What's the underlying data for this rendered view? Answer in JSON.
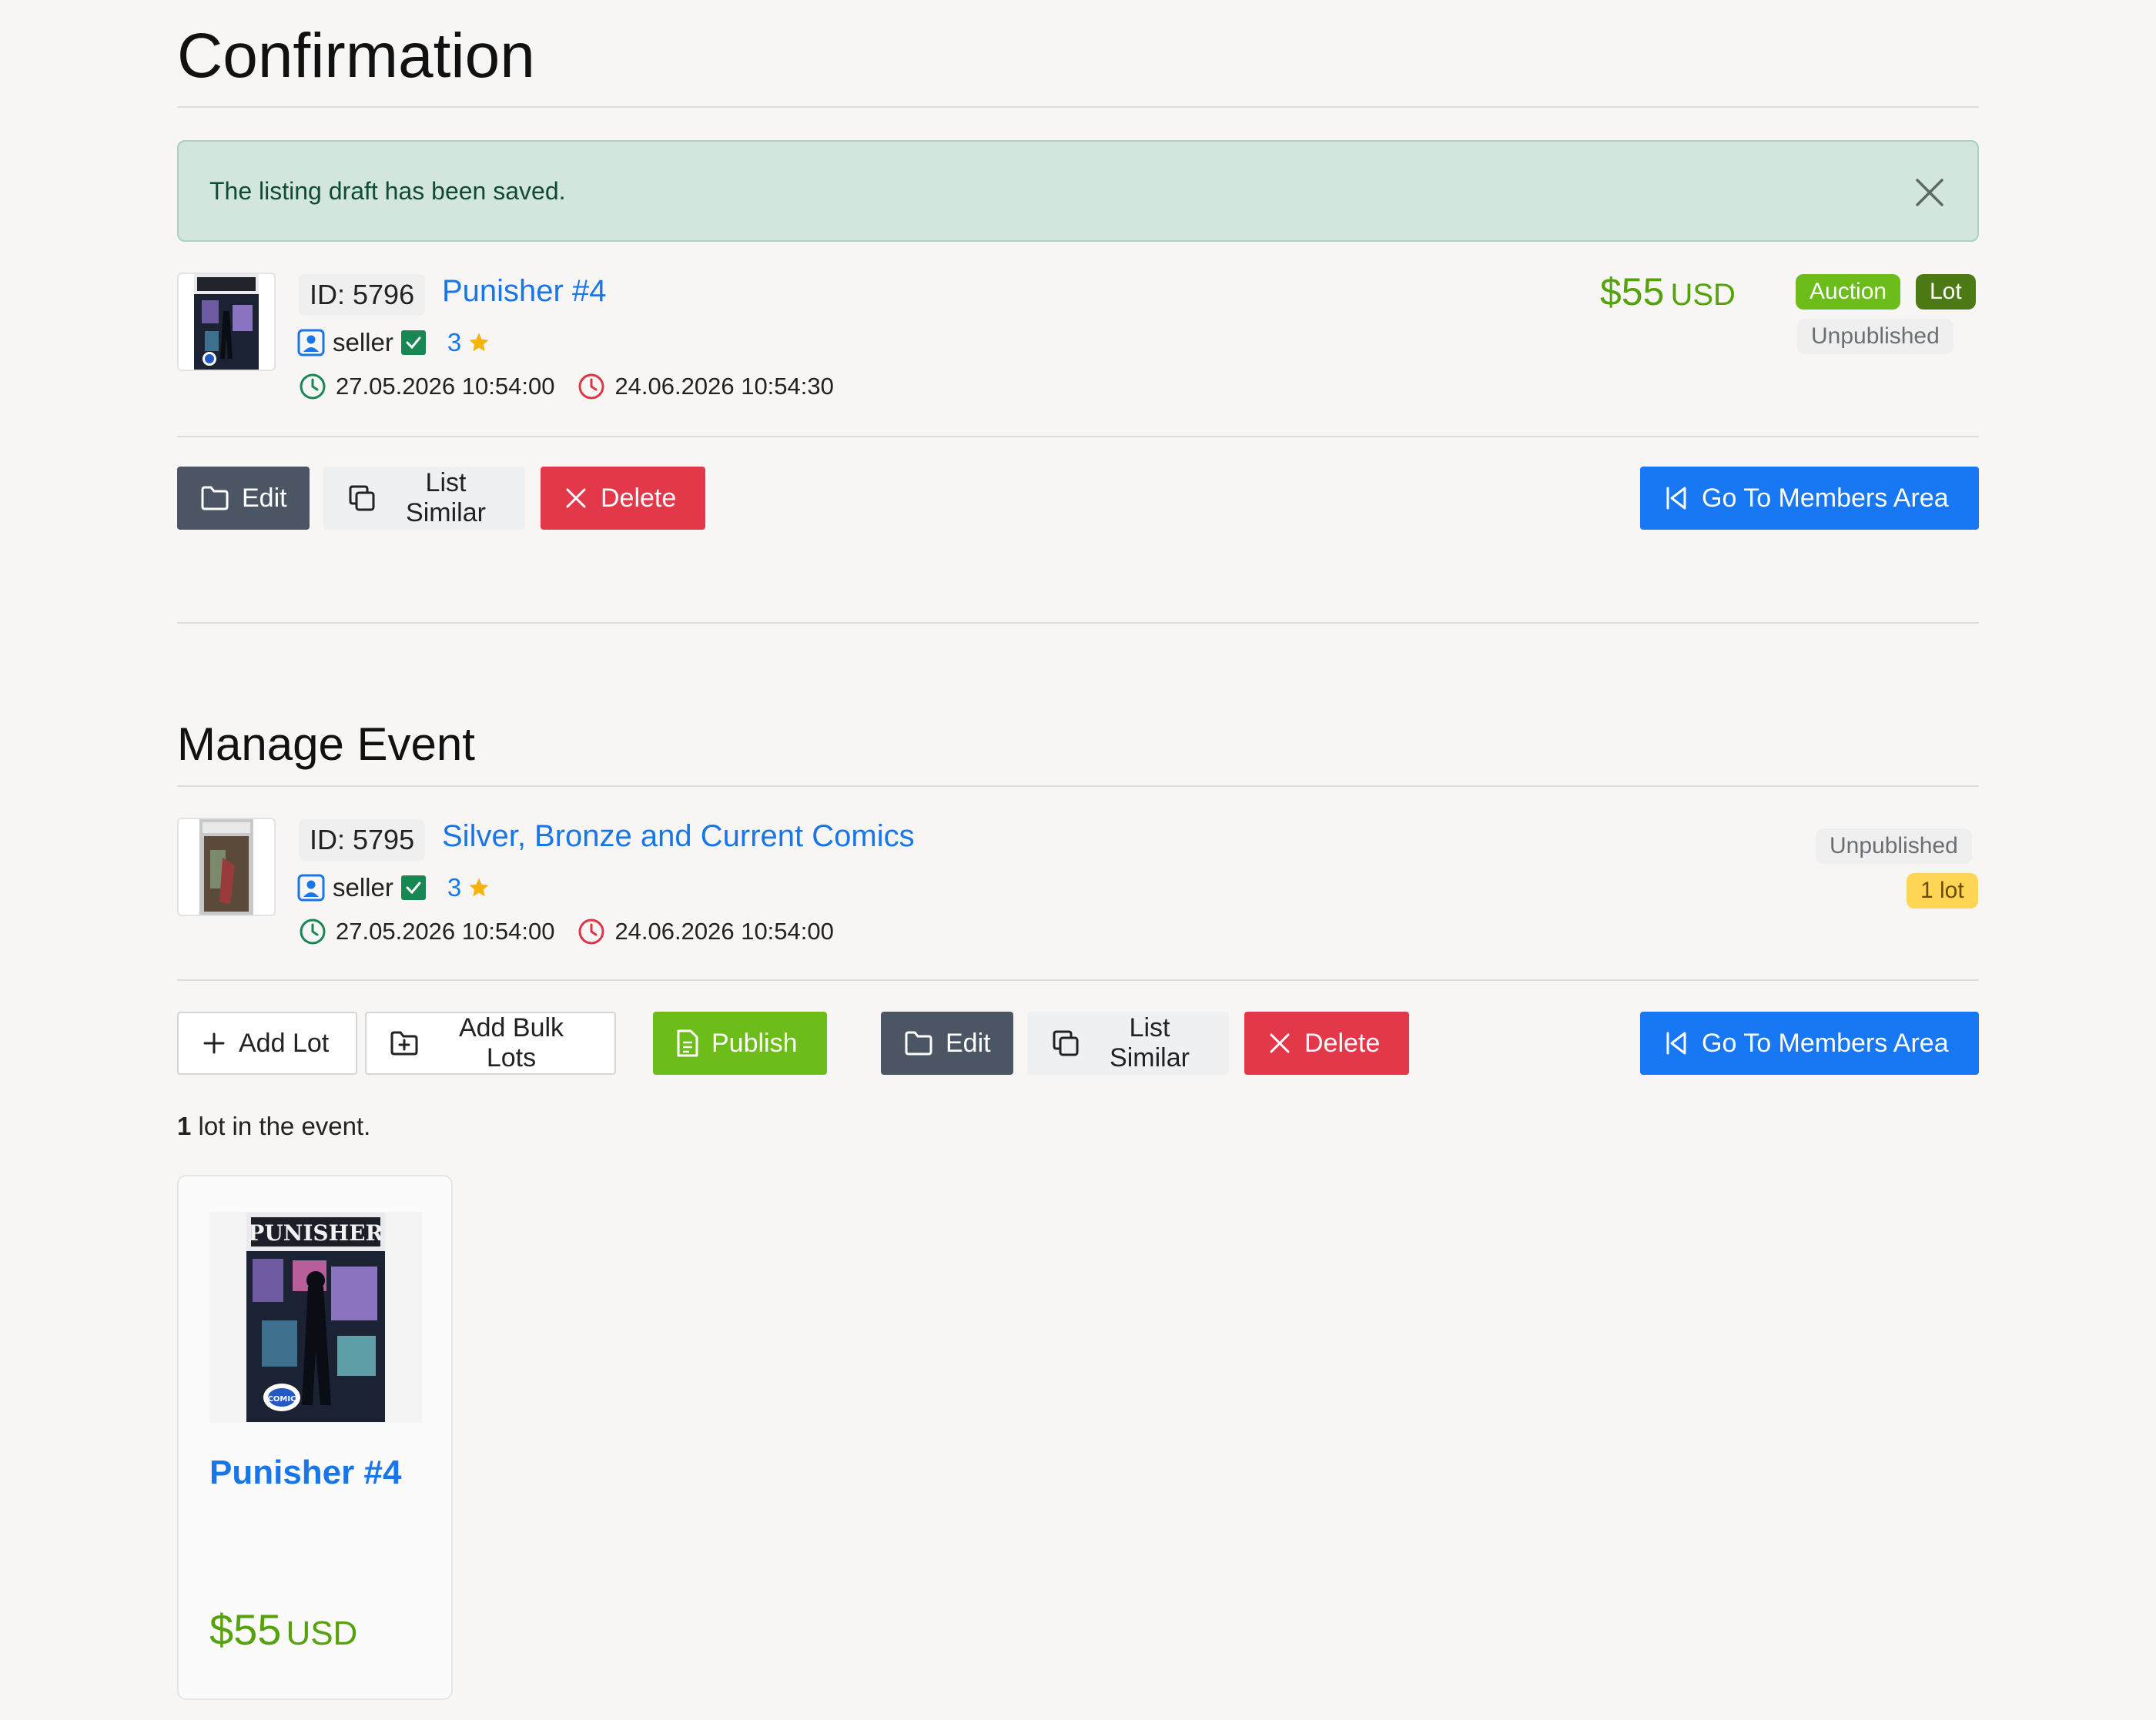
{
  "confirmation": {
    "title": "Confirmation",
    "alert": {
      "message": "The listing draft has been saved."
    },
    "listing": {
      "id_label": "ID: 5796",
      "title": "Punisher #4",
      "seller": "seller",
      "rating": "3",
      "start_date": "27.05.2026 10:54:00",
      "end_date": "24.06.2026 10:54:30",
      "price_amount": "$55",
      "price_currency": "USD",
      "badge_type": "Auction",
      "badge_kind": "Lot",
      "status": "Unpublished"
    },
    "buttons": {
      "edit": "Edit",
      "list_similar": "List Similar",
      "delete": "Delete",
      "members": "Go To Members Area"
    }
  },
  "manage_event": {
    "title": "Manage Event",
    "event": {
      "id_label": "ID: 5795",
      "title": "Silver, Bronze and Current Comics",
      "seller": "seller",
      "rating": "3",
      "start_date": "27.05.2026 10:54:00",
      "end_date": "24.06.2026 10:54:00",
      "status": "Unpublished",
      "lot_badge": "1 lot"
    },
    "buttons": {
      "add_lot": "Add Lot",
      "add_bulk": "Add Bulk Lots",
      "publish": "Publish",
      "edit": "Edit",
      "list_similar": "List Similar",
      "delete": "Delete",
      "members": "Go To Members Area"
    },
    "lot_count_number": "1",
    "lot_count_text": " lot in the event.",
    "card": {
      "title": "Punisher #4",
      "price_amount": "$55",
      "price_currency": "USD"
    }
  },
  "colors": {
    "link": "#1976e6",
    "price": "#55a20d",
    "auction_badge": "#6cbd19",
    "lot_badge": "#4d7a14",
    "danger": "#e3384a",
    "primary": "#1877f2"
  },
  "icons": {
    "close": "close-icon",
    "user": "user-square-icon",
    "verified": "check-square-icon",
    "star": "star-icon",
    "clock_start": "clock-icon",
    "clock_end": "clock-icon",
    "folder": "folder-icon",
    "copy": "copy-icon",
    "x": "x-icon",
    "back": "skip-back-icon",
    "plus": "plus-icon",
    "folder_plus": "folder-plus-icon",
    "document": "document-icon"
  }
}
